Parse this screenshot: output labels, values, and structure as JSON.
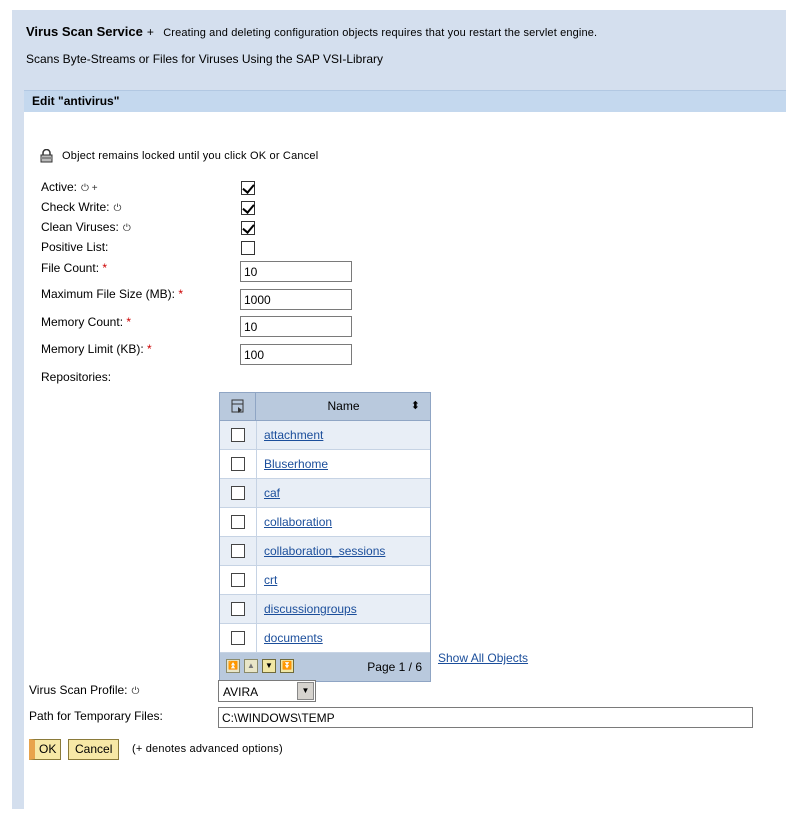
{
  "header": {
    "service_name": "Virus Scan Service",
    "service_plus": "+",
    "restart_note": "Creating and deleting configuration objects requires that you restart the servlet engine.",
    "description": "Scans Byte-Streams or Files for Viruses Using the SAP VSI-Library"
  },
  "panel": {
    "title": "Edit \"antivirus\"",
    "lock_message": "Object remains locked until you click OK or Cancel"
  },
  "fields": {
    "active": {
      "label": "Active:",
      "advanced": "⏻ +",
      "checked": true
    },
    "check_write": {
      "label": "Check Write:",
      "advanced": "⏻",
      "checked": true
    },
    "clean_viruses": {
      "label": "Clean Viruses:",
      "advanced": "⏻",
      "checked": true
    },
    "positive_list": {
      "label": "Positive List:",
      "checked": false
    },
    "file_count": {
      "label": "File Count:",
      "required": "*",
      "value": "10"
    },
    "max_file_size": {
      "label": "Maximum File Size (MB):",
      "required": "*",
      "value": "1000"
    },
    "memory_count": {
      "label": "Memory Count:",
      "required": "*",
      "value": "10"
    },
    "memory_limit": {
      "label": "Memory Limit (KB):",
      "required": "*",
      "value": "100"
    },
    "repositories": {
      "label": "Repositories:"
    },
    "virus_scan_profile": {
      "label": "Virus Scan Profile:",
      "advanced": "⏻",
      "value": "AVIRA"
    },
    "temp_path": {
      "label": "Path for Temporary Files:",
      "value": "C:\\WINDOWS\\TEMP"
    }
  },
  "repo_table": {
    "column_header": "Name",
    "rows": [
      "attachment",
      "Bluserhome",
      "caf",
      "collaboration",
      "collaboration_sessions",
      "crt",
      "discussiongroups",
      "documents"
    ],
    "page_label": "Page 1 / 6",
    "show_all": "Show All Objects"
  },
  "buttons": {
    "ok": "OK",
    "cancel": "Cancel"
  },
  "legend": "(+ denotes advanced options)"
}
